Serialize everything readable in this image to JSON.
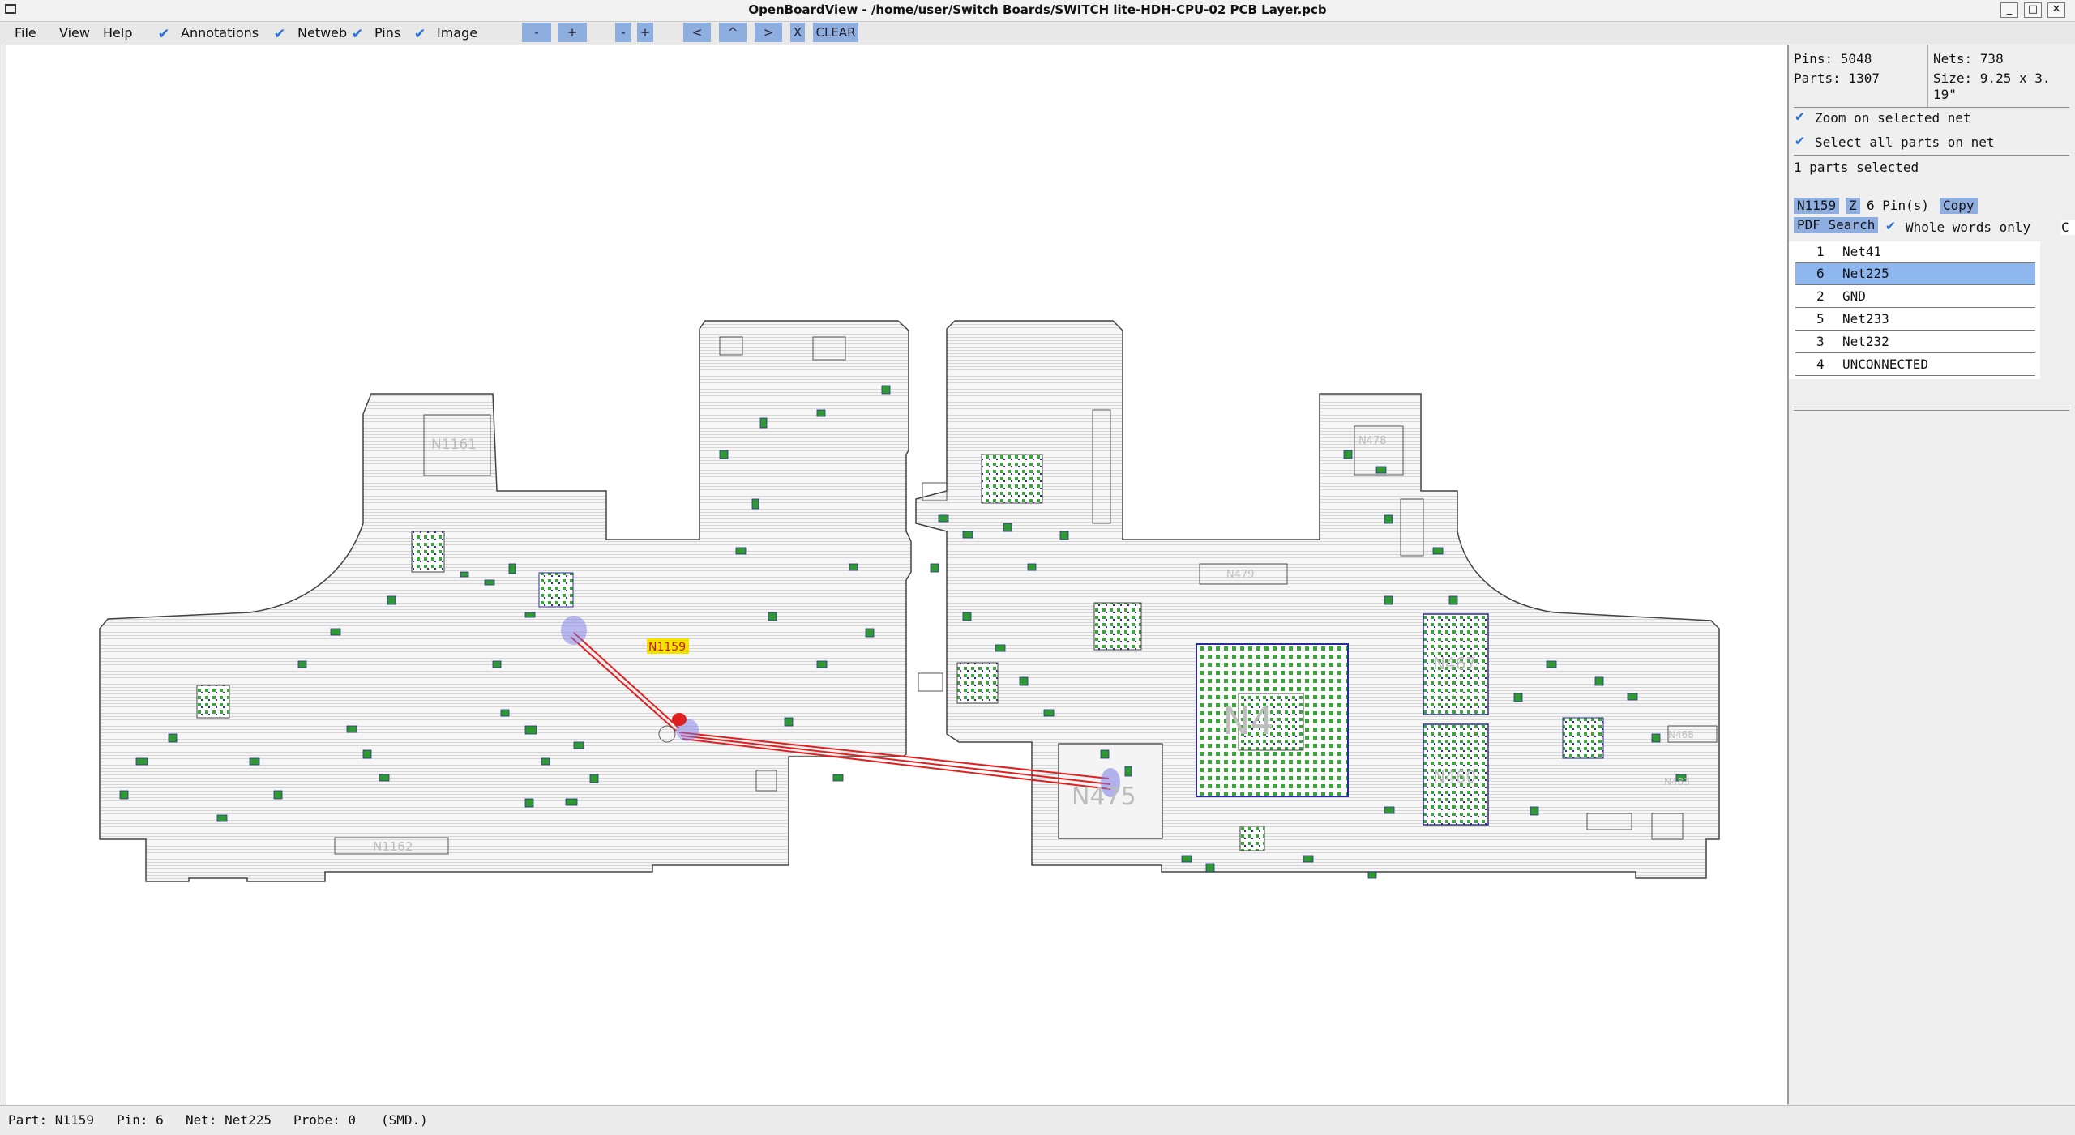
{
  "window": {
    "title": "OpenBoardView - /home/user/Switch Boards/SWITCH lite-HDH-CPU-02 PCB Layer.pcb"
  },
  "menu": {
    "file": "File",
    "view": "View",
    "help": "Help"
  },
  "toolbar": {
    "annotations": "Annotations",
    "netweb": "Netweb",
    "pins": "Pins",
    "image": "Image",
    "zoom_out": "-",
    "zoom_in": "+",
    "zoom_out2": "-",
    "zoom_in2": "+",
    "left": "<",
    "up": "^",
    "right": ">",
    "x": "X",
    "clear": "CLEAR"
  },
  "board": {
    "labels": [
      "N1161",
      "N1162",
      "N1159",
      "N475",
      "N478",
      "N467",
      "N460",
      "N479",
      "N483",
      "N468",
      "N4"
    ],
    "selected_part": "N1159"
  },
  "panel": {
    "pins": "Pins: 5048",
    "nets": "Nets: 738",
    "parts": "Parts: 1307",
    "size_line1": "Size: 9.25 x 3.",
    "size_line2": "19\"",
    "zoom_selected": "Zoom on selected net",
    "select_all_parts": "Select all parts on net",
    "parts_selected": "1 parts selected",
    "part_name": "N1159",
    "z": "Z",
    "pins_count": "6 Pin(s)",
    "copy": "Copy",
    "pdf_search": "PDF Search",
    "whole_words": "Whole words only",
    "cut": "C",
    "pin_list": [
      {
        "pin": "1",
        "net": "Net41",
        "selected": false
      },
      {
        "pin": "6",
        "net": "Net225",
        "selected": true
      },
      {
        "pin": "2",
        "net": "GND",
        "selected": false
      },
      {
        "pin": "5",
        "net": "Net233",
        "selected": false
      },
      {
        "pin": "3",
        "net": "Net232",
        "selected": false
      },
      {
        "pin": "4",
        "net": "UNCONNECTED",
        "selected": false
      }
    ]
  },
  "status": {
    "part": "Part: N1159",
    "pin": "Pin: 6",
    "net": "Net: Net225",
    "probe": "Probe: 0",
    "smd": "(SMD.)"
  },
  "colors": {
    "accent": "#8eaee0",
    "selection": "#8eb7f0",
    "check": "#2a6fdb",
    "net_line": "#e02020"
  }
}
